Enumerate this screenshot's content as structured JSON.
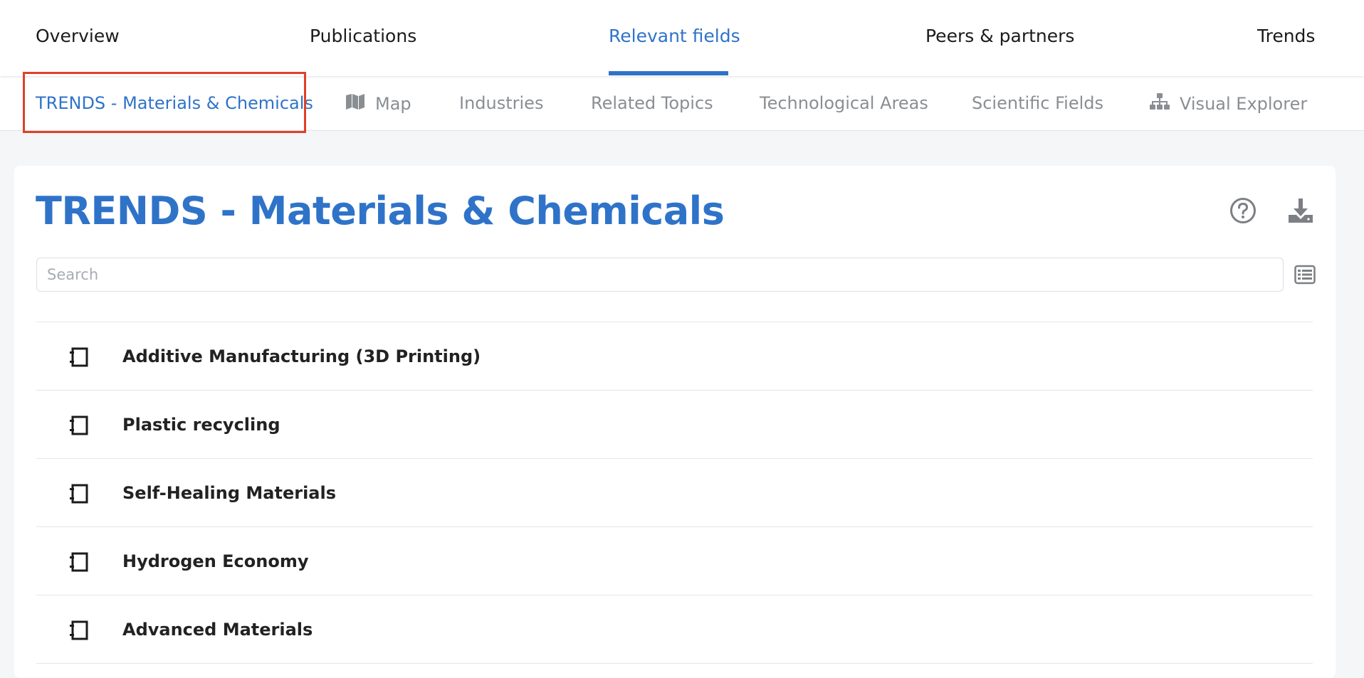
{
  "top_tabs": [
    {
      "label": "Overview"
    },
    {
      "label": "Publications"
    },
    {
      "label": "Relevant fields"
    },
    {
      "label": "Peers & partners"
    },
    {
      "label": "Trends"
    }
  ],
  "sub_tabs": [
    {
      "label": "TRENDS - Materials & Chemicals"
    },
    {
      "label": "Map",
      "icon": "map-icon"
    },
    {
      "label": "Industries"
    },
    {
      "label": "Related Topics"
    },
    {
      "label": "Technological Areas"
    },
    {
      "label": "Scientific Fields"
    },
    {
      "label": "Visual Explorer",
      "icon": "sitemap-icon"
    }
  ],
  "main": {
    "title": "TRENDS - Materials & Chemicals",
    "search_placeholder": "Search",
    "items": [
      {
        "label": "Additive Manufacturing (3D Printing)"
      },
      {
        "label": "Plastic recycling"
      },
      {
        "label": "Self-Healing Materials"
      },
      {
        "label": "Hydrogen Economy"
      },
      {
        "label": "Advanced Materials"
      }
    ]
  },
  "colors": {
    "accent": "#2f73c9",
    "highlight": "#e0402a",
    "muted_text": "#8a8e93"
  }
}
